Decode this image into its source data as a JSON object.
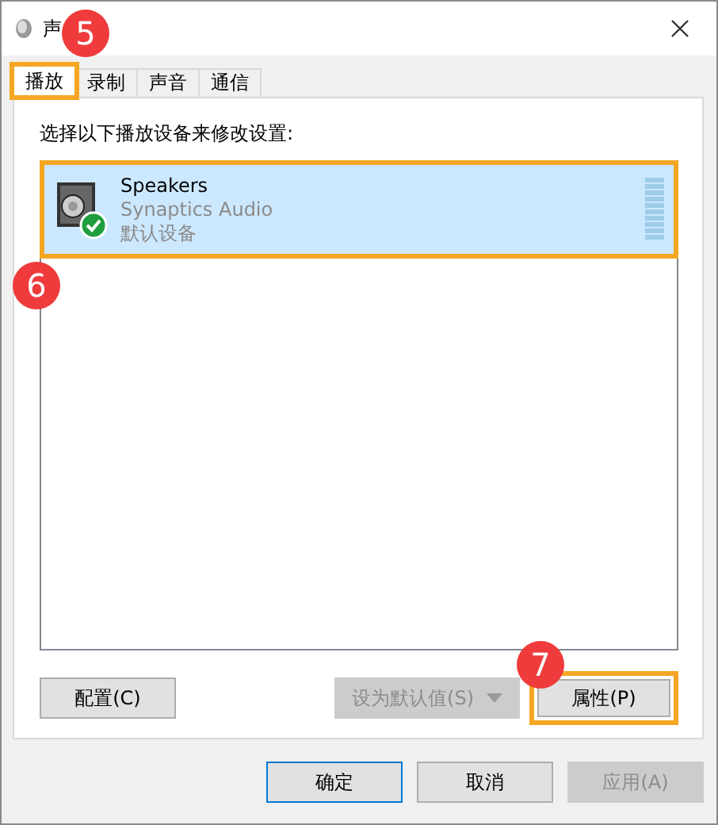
{
  "window": {
    "title": "声"
  },
  "tabs": [
    {
      "label": "播放",
      "selected": true,
      "highlighted": true
    },
    {
      "label": "录制",
      "selected": false,
      "highlighted": false
    },
    {
      "label": "声音",
      "selected": false,
      "highlighted": false
    },
    {
      "label": "通信",
      "selected": false,
      "highlighted": false
    }
  ],
  "instruction": "选择以下播放设备来修改设置:",
  "devices": [
    {
      "name": "Speakers",
      "driver": "Synaptics Audio",
      "status": "默认设备",
      "selected": true,
      "default": true,
      "highlighted": true
    }
  ],
  "panel_buttons": [
    {
      "label": "配置(C)",
      "disabled": false,
      "kind": "plain",
      "highlighted": false
    },
    {
      "label": "设为默认值(S)",
      "disabled": true,
      "kind": "split",
      "highlighted": false
    },
    {
      "label": "属性(P)",
      "disabled": false,
      "kind": "plain",
      "highlighted": true
    }
  ],
  "dialog_buttons": [
    {
      "label": "确定",
      "disabled": false,
      "default": true
    },
    {
      "label": "取消",
      "disabled": false,
      "default": false
    },
    {
      "label": "应用(A)",
      "disabled": true,
      "default": false
    }
  ],
  "callouts": [
    {
      "number": "5"
    },
    {
      "number": "6"
    },
    {
      "number": "7"
    }
  ]
}
